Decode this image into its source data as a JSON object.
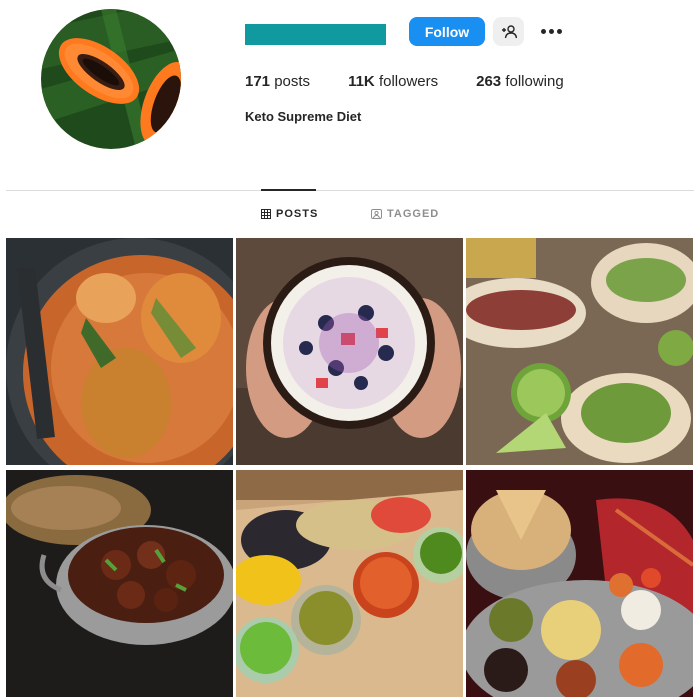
{
  "profile": {
    "username_redacted_color": "#109a9f",
    "follow_label": "Follow",
    "stats": {
      "posts_count": "171",
      "posts_label": "posts",
      "followers_count": "11K",
      "followers_label": "followers",
      "following_count": "263",
      "following_label": "following"
    },
    "bio_name": "Keto Supreme Diet"
  },
  "tabs": {
    "posts_label": "POSTS",
    "tagged_label": "TAGGED"
  },
  "icons": {
    "avatar": "papaya-photo",
    "add_user": "add-user-icon",
    "more": "more-options-icon",
    "posts": "grid-icon",
    "tagged": "tagged-icon"
  },
  "colors": {
    "follow_button": "#1a8ff2",
    "username_bar": "#109a9f"
  },
  "posts": [
    {
      "subject": "curry-chicken-photo"
    },
    {
      "subject": "coconut-fruit-bowl-photo"
    },
    {
      "subject": "tacos-lime-photo"
    },
    {
      "subject": "beef-curry-bowl-photo"
    },
    {
      "subject": "dips-platter-photo"
    },
    {
      "subject": "thali-platter-photo"
    }
  ]
}
